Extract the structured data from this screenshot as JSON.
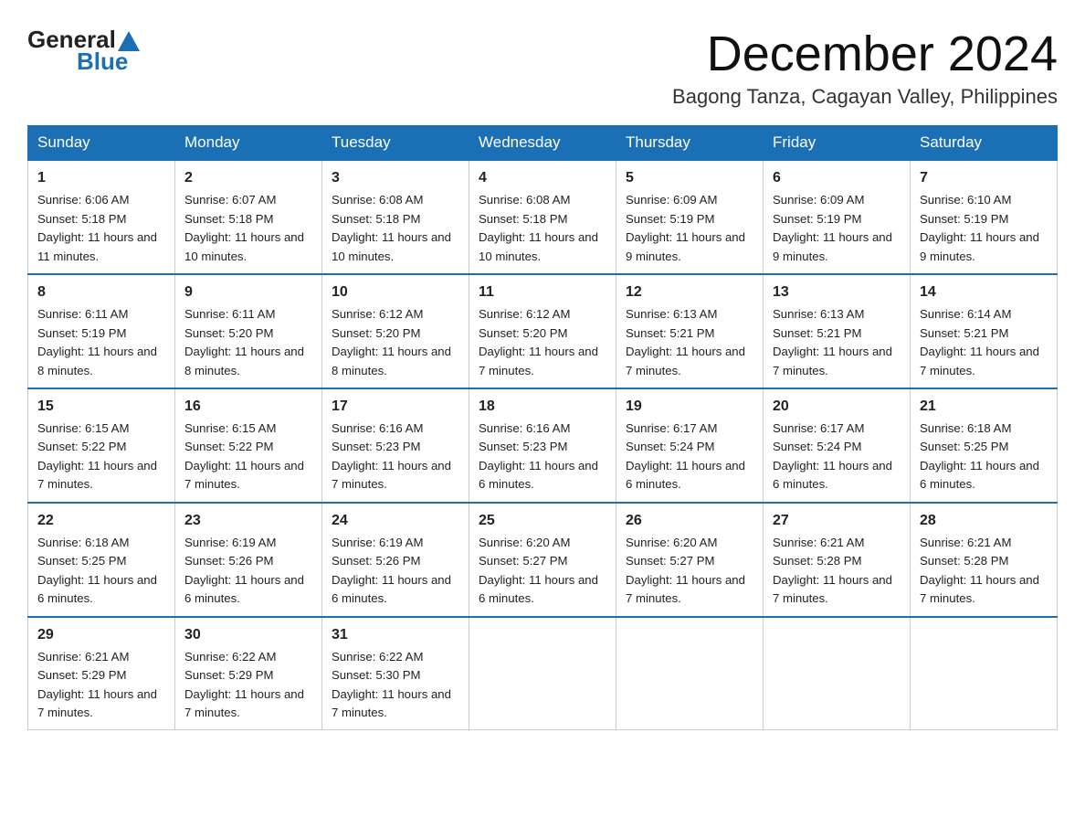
{
  "logo": {
    "general": "General",
    "blue": "Blue"
  },
  "header": {
    "month": "December 2024",
    "location": "Bagong Tanza, Cagayan Valley, Philippines"
  },
  "weekdays": [
    "Sunday",
    "Monday",
    "Tuesday",
    "Wednesday",
    "Thursday",
    "Friday",
    "Saturday"
  ],
  "weeks": [
    [
      {
        "day": "1",
        "sunrise": "6:06 AM",
        "sunset": "5:18 PM",
        "daylight": "11 hours and 11 minutes."
      },
      {
        "day": "2",
        "sunrise": "6:07 AM",
        "sunset": "5:18 PM",
        "daylight": "11 hours and 10 minutes."
      },
      {
        "day": "3",
        "sunrise": "6:08 AM",
        "sunset": "5:18 PM",
        "daylight": "11 hours and 10 minutes."
      },
      {
        "day": "4",
        "sunrise": "6:08 AM",
        "sunset": "5:18 PM",
        "daylight": "11 hours and 10 minutes."
      },
      {
        "day": "5",
        "sunrise": "6:09 AM",
        "sunset": "5:19 PM",
        "daylight": "11 hours and 9 minutes."
      },
      {
        "day": "6",
        "sunrise": "6:09 AM",
        "sunset": "5:19 PM",
        "daylight": "11 hours and 9 minutes."
      },
      {
        "day": "7",
        "sunrise": "6:10 AM",
        "sunset": "5:19 PM",
        "daylight": "11 hours and 9 minutes."
      }
    ],
    [
      {
        "day": "8",
        "sunrise": "6:11 AM",
        "sunset": "5:19 PM",
        "daylight": "11 hours and 8 minutes."
      },
      {
        "day": "9",
        "sunrise": "6:11 AM",
        "sunset": "5:20 PM",
        "daylight": "11 hours and 8 minutes."
      },
      {
        "day": "10",
        "sunrise": "6:12 AM",
        "sunset": "5:20 PM",
        "daylight": "11 hours and 8 minutes."
      },
      {
        "day": "11",
        "sunrise": "6:12 AM",
        "sunset": "5:20 PM",
        "daylight": "11 hours and 7 minutes."
      },
      {
        "day": "12",
        "sunrise": "6:13 AM",
        "sunset": "5:21 PM",
        "daylight": "11 hours and 7 minutes."
      },
      {
        "day": "13",
        "sunrise": "6:13 AM",
        "sunset": "5:21 PM",
        "daylight": "11 hours and 7 minutes."
      },
      {
        "day": "14",
        "sunrise": "6:14 AM",
        "sunset": "5:21 PM",
        "daylight": "11 hours and 7 minutes."
      }
    ],
    [
      {
        "day": "15",
        "sunrise": "6:15 AM",
        "sunset": "5:22 PM",
        "daylight": "11 hours and 7 minutes."
      },
      {
        "day": "16",
        "sunrise": "6:15 AM",
        "sunset": "5:22 PM",
        "daylight": "11 hours and 7 minutes."
      },
      {
        "day": "17",
        "sunrise": "6:16 AM",
        "sunset": "5:23 PM",
        "daylight": "11 hours and 7 minutes."
      },
      {
        "day": "18",
        "sunrise": "6:16 AM",
        "sunset": "5:23 PM",
        "daylight": "11 hours and 6 minutes."
      },
      {
        "day": "19",
        "sunrise": "6:17 AM",
        "sunset": "5:24 PM",
        "daylight": "11 hours and 6 minutes."
      },
      {
        "day": "20",
        "sunrise": "6:17 AM",
        "sunset": "5:24 PM",
        "daylight": "11 hours and 6 minutes."
      },
      {
        "day": "21",
        "sunrise": "6:18 AM",
        "sunset": "5:25 PM",
        "daylight": "11 hours and 6 minutes."
      }
    ],
    [
      {
        "day": "22",
        "sunrise": "6:18 AM",
        "sunset": "5:25 PM",
        "daylight": "11 hours and 6 minutes."
      },
      {
        "day": "23",
        "sunrise": "6:19 AM",
        "sunset": "5:26 PM",
        "daylight": "11 hours and 6 minutes."
      },
      {
        "day": "24",
        "sunrise": "6:19 AM",
        "sunset": "5:26 PM",
        "daylight": "11 hours and 6 minutes."
      },
      {
        "day": "25",
        "sunrise": "6:20 AM",
        "sunset": "5:27 PM",
        "daylight": "11 hours and 6 minutes."
      },
      {
        "day": "26",
        "sunrise": "6:20 AM",
        "sunset": "5:27 PM",
        "daylight": "11 hours and 7 minutes."
      },
      {
        "day": "27",
        "sunrise": "6:21 AM",
        "sunset": "5:28 PM",
        "daylight": "11 hours and 7 minutes."
      },
      {
        "day": "28",
        "sunrise": "6:21 AM",
        "sunset": "5:28 PM",
        "daylight": "11 hours and 7 minutes."
      }
    ],
    [
      {
        "day": "29",
        "sunrise": "6:21 AM",
        "sunset": "5:29 PM",
        "daylight": "11 hours and 7 minutes."
      },
      {
        "day": "30",
        "sunrise": "6:22 AM",
        "sunset": "5:29 PM",
        "daylight": "11 hours and 7 minutes."
      },
      {
        "day": "31",
        "sunrise": "6:22 AM",
        "sunset": "5:30 PM",
        "daylight": "11 hours and 7 minutes."
      },
      null,
      null,
      null,
      null
    ]
  ],
  "labels": {
    "sunrise": "Sunrise:",
    "sunset": "Sunset:",
    "daylight": "Daylight:"
  }
}
